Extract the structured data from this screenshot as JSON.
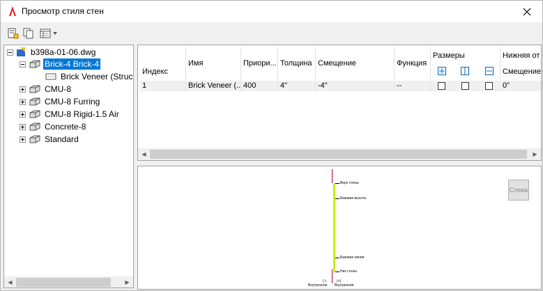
{
  "window": {
    "title": "Просмотр стиля стен"
  },
  "toolbar": {
    "icons": [
      "edit-style-icon",
      "copy-icon",
      "view-options-icon"
    ]
  },
  "tree": {
    "root": "b398a-01-06.dwg",
    "items": [
      {
        "label": "Brick-4 Brick-4",
        "selected": true,
        "expanded": true
      },
      {
        "label": "Brick Veneer (Structure)",
        "child": true
      },
      {
        "label": "CMU-8"
      },
      {
        "label": "CMU-8 Furring"
      },
      {
        "label": "CMU-8 Rigid-1.5 Air"
      },
      {
        "label": "Concrete-8"
      },
      {
        "label": "Standard"
      }
    ]
  },
  "grid": {
    "headers": {
      "index": "Индекс",
      "name": "Имя",
      "priority": "Приори...",
      "thickness": "Толщина",
      "offset": "Смещение",
      "function": "Функция",
      "dimensions": "Размеры",
      "bottom": "Нижняя от",
      "bottom_offset": "Смещение"
    },
    "row": {
      "index": "1",
      "name": "Brick Veneer (...",
      "priority": "400",
      "thickness": "4\"",
      "offset": "-4\"",
      "function": "--",
      "bottom_offset": "0\""
    }
  },
  "preview": {
    "view_button": "Слева",
    "labels": {
      "top": "Верх стены",
      "baseline_height": "Базовая высота",
      "baseline": "Базовая линия",
      "bottom": "Низ стены",
      "outer_left": "Внутренняя",
      "outer_right": "Внутренняя",
      "sign_left": "(-)",
      "sign_right": "(+)"
    }
  },
  "colors": {
    "selection": "#0078d7",
    "wall": "#c8f000",
    "marker": "#b00040"
  }
}
